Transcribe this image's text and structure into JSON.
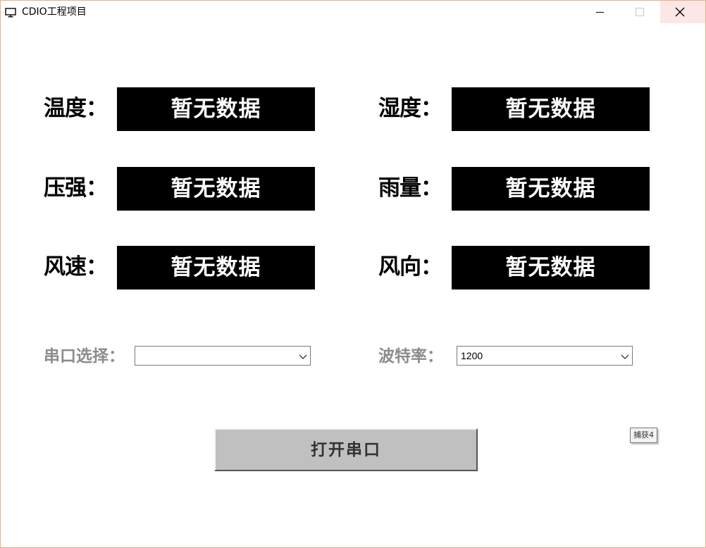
{
  "window": {
    "title": "CDIO工程项目",
    "icon": "monitor-icon"
  },
  "controls": {
    "minimize_icon": "minimize-icon",
    "maximize_icon": "maximize-icon",
    "close_icon": "close-icon",
    "close_hover_color": "#fde6e6"
  },
  "readings": {
    "temperature": {
      "label": "温度：",
      "value": "暂无数据"
    },
    "humidity": {
      "label": "湿度：",
      "value": "暂无数据"
    },
    "pressure": {
      "label": "压强：",
      "value": "暂无数据"
    },
    "rainfall": {
      "label": "雨量：",
      "value": "暂无数据"
    },
    "wind_speed": {
      "label": "风速：",
      "value": "暂无数据"
    },
    "wind_direction": {
      "label": "风向：",
      "value": "暂无数据"
    }
  },
  "serial": {
    "port_label": "串口选择：",
    "port_value": "",
    "baud_label": "波特率：",
    "baud_value": "1200",
    "dropdown_icon": "chevron-down-icon"
  },
  "actions": {
    "open_port_label": "打开串口"
  },
  "tooltip": {
    "text": "捕获4"
  },
  "colors": {
    "value_box_bg": "#000000",
    "value_text": "#ffffff",
    "label_text": "#000000",
    "gray_label": "#8c8c8c",
    "button_bg": "#c0c0c0"
  }
}
